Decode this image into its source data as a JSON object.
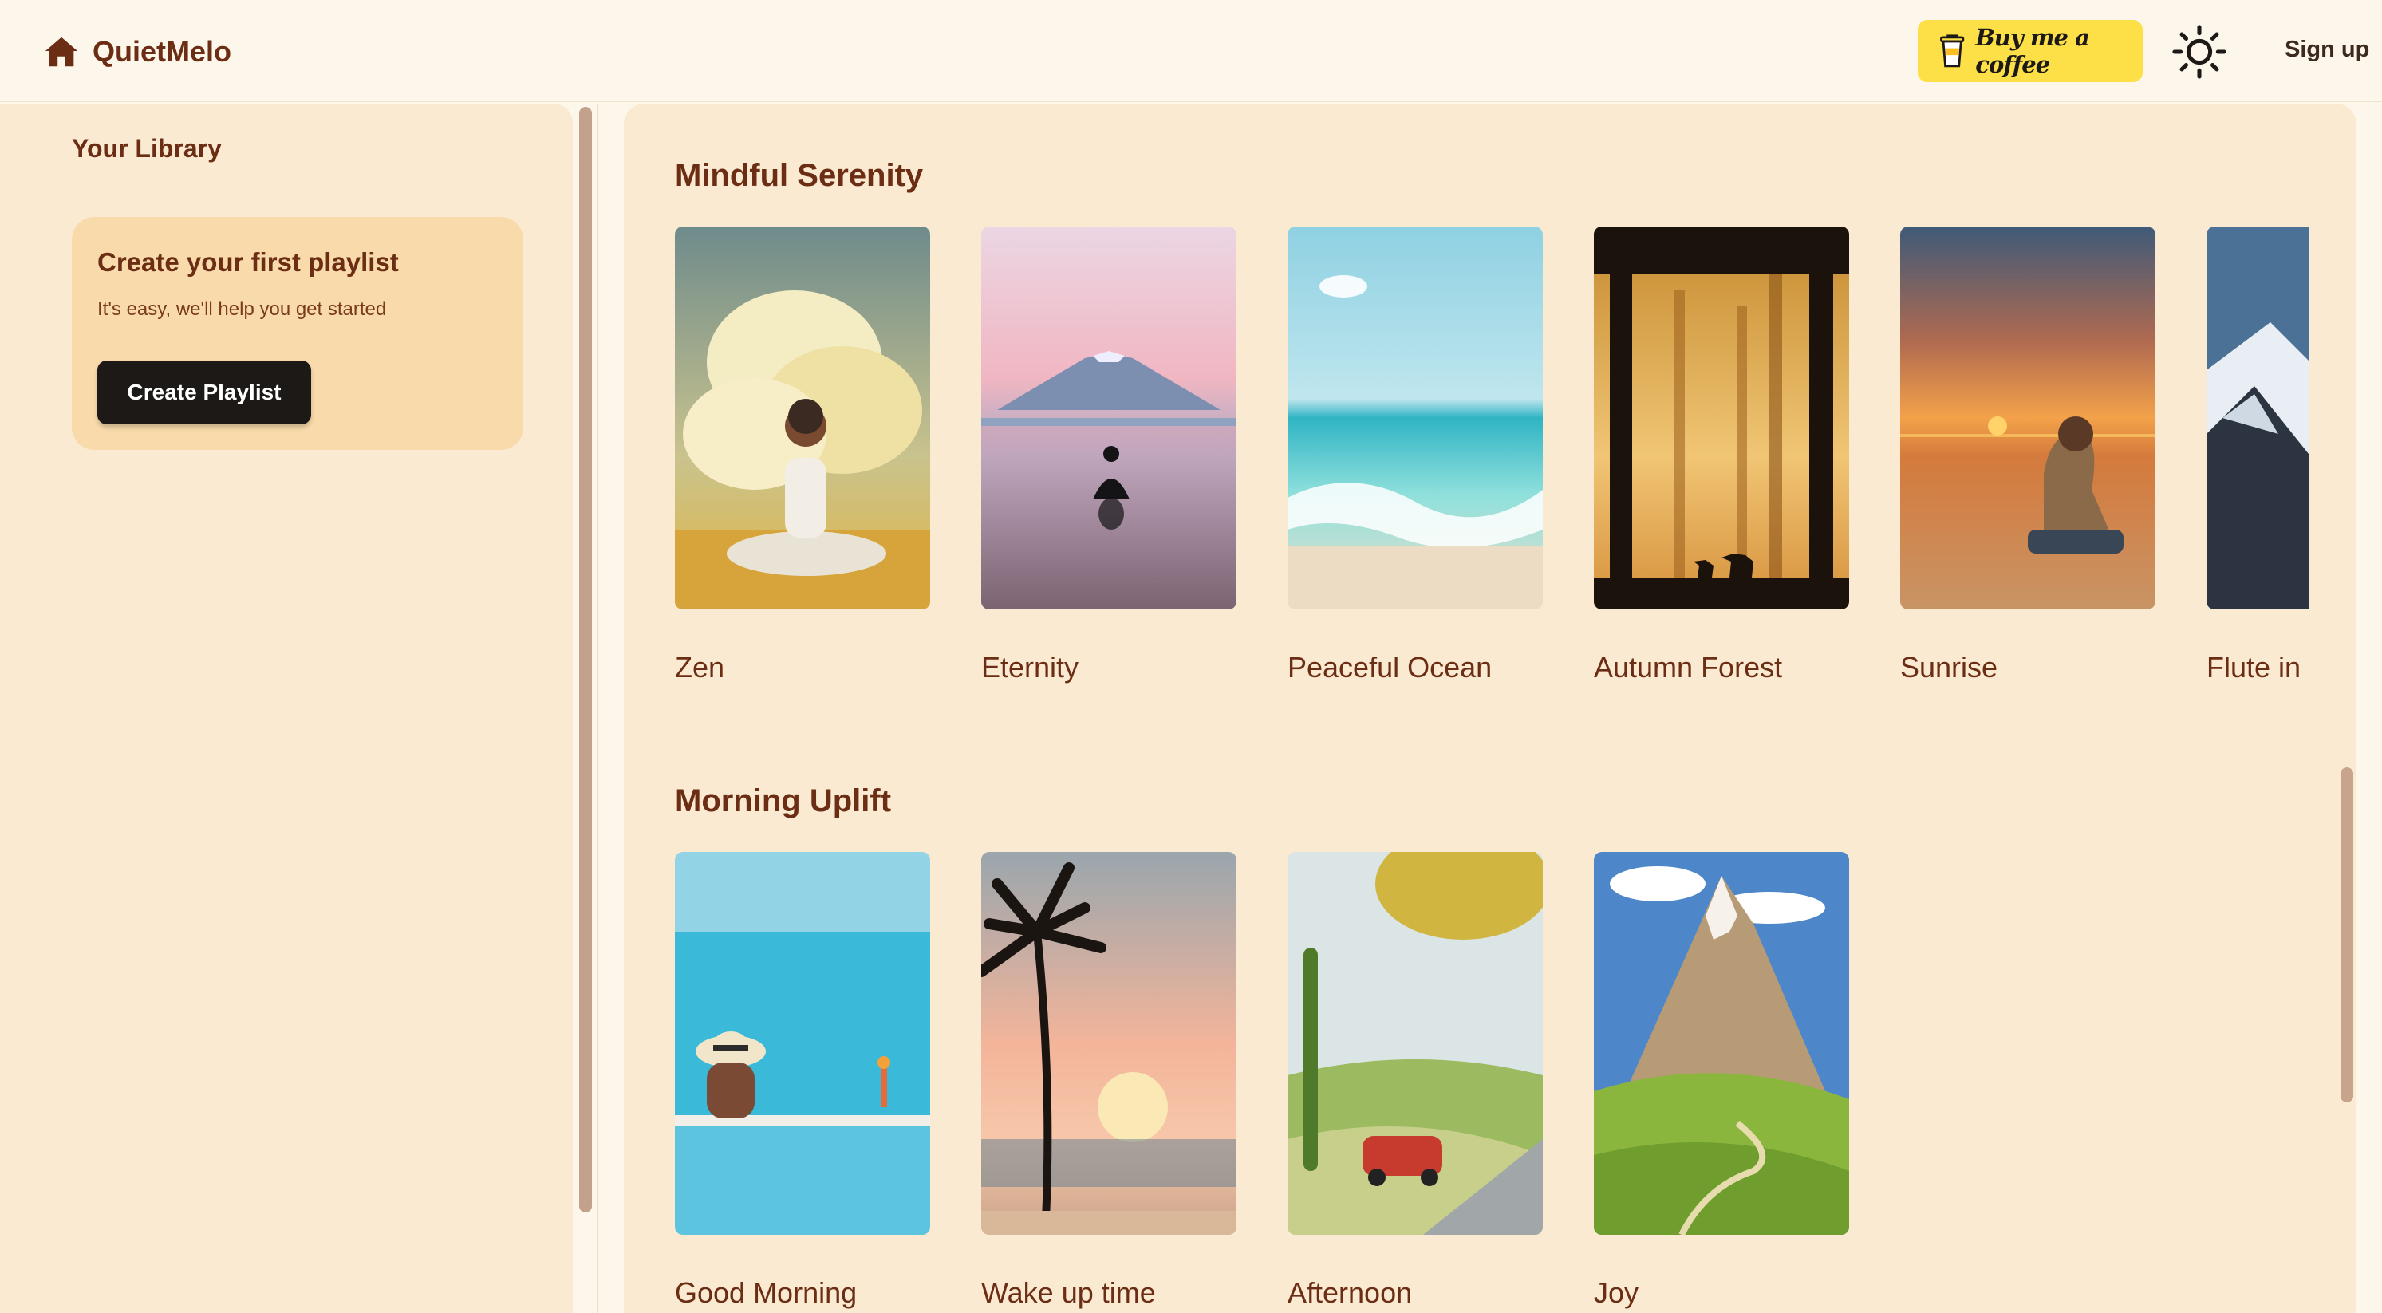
{
  "app": {
    "name": "QuietMelo",
    "home_icon": "home-icon",
    "coffee_label": "Buy me a coffee",
    "coffee_icon": "coffee-cup-icon",
    "theme_icon": "sun-icon",
    "signup_label": "Sign up"
  },
  "sidebar": {
    "title": "Your Library",
    "promo": {
      "title": "Create your first playlist",
      "subtitle": "It's easy, we'll help you get started",
      "button_label": "Create Playlist"
    }
  },
  "sections": [
    {
      "title": "Mindful Serenity",
      "items": [
        {
          "label": "Zen",
          "art": "meditating-woman-clouds"
        },
        {
          "label": "Eternity",
          "art": "mountain-reflection-silhouette"
        },
        {
          "label": "Peaceful Ocean",
          "art": "beach-waves"
        },
        {
          "label": "Autumn Forest",
          "art": "forest-deer-silhouette"
        },
        {
          "label": "Sunrise",
          "art": "woman-beach-sunset"
        },
        {
          "label": "Flute in",
          "art": "snowy-mountains"
        }
      ]
    },
    {
      "title": "Morning Uplift",
      "items": [
        {
          "label": "Good Morning",
          "art": "pool-sunhat"
        },
        {
          "label": "Wake up time",
          "art": "palm-tree-sunset"
        },
        {
          "label": "Afternoon",
          "art": "countryside-red-car"
        },
        {
          "label": "Joy",
          "art": "green-mountain-valley"
        }
      ]
    }
  ],
  "colors": {
    "background": "#fdf6ea",
    "panel": "#fbead2",
    "accent_text": "#6b2d14",
    "coffee_button": "#fde047",
    "primary_button": "#1c1917"
  }
}
